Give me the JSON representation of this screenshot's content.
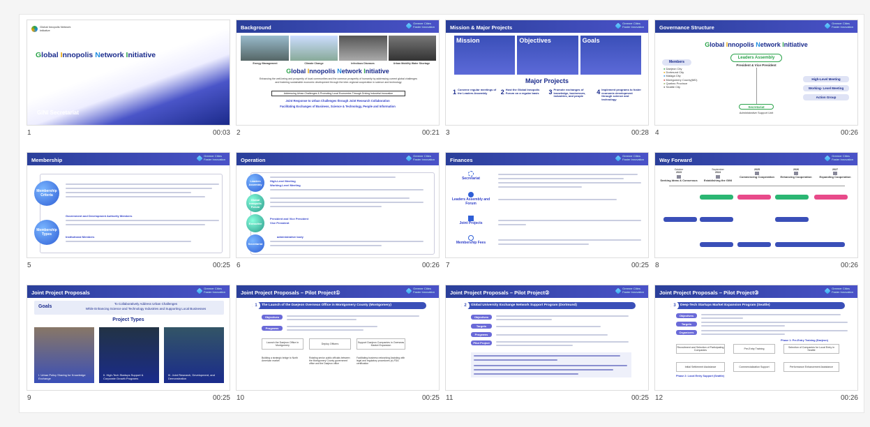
{
  "brand": {
    "line1": "Greener Cities",
    "line2": "Faster Innovation"
  },
  "gini": {
    "pre1": "G",
    "w1": "lobal ",
    "pre2": "I",
    "w2": "nnopolis ",
    "pre3": "N",
    "w3": "etwork ",
    "pre4": "I",
    "w4": "nitiative"
  },
  "slides": [
    {
      "num": "1",
      "duration": "00:03",
      "title": "",
      "footer": "GINI Secretariat",
      "logo_text": "Global Innopolis Network Initiative"
    },
    {
      "num": "2",
      "duration": "00:21",
      "title": "Background",
      "images": [
        "Energy Management",
        "Climate Change",
        "Infectious Diseases",
        "Urban Mobility Water Shortage"
      ],
      "body": "Enhancing the well-being and prosperity of local communities and the common prosperity of humanity by addressing current global challenges and fostering sustainable economic development through the inter-regional cooperation in science and technology",
      "box": "Addressing Urban Challenges & Promoting Local Economies Through Driving Industrial Innovation",
      "line1": "Joint Response to Urban Challenges through Joint Research Collaboration",
      "line2": "Facilitating Exchanges of Business, Science & Technology, People and Information"
    },
    {
      "num": "3",
      "duration": "00:28",
      "title": "Mission & Major Projects",
      "cols": [
        "Mission",
        "Objectives",
        "Goals"
      ],
      "major": "Major Projects",
      "projects": [
        {
          "n": "1",
          "t": "Convene regular meetings of the Leaders Assembly"
        },
        {
          "n": "2",
          "t": "Host the Global Innopolis Forum on a regular basis"
        },
        {
          "n": "3",
          "t": "Promote exchanges of knowledge, businesses, industries, and people"
        },
        {
          "n": "4",
          "t": "Implement programs to foster economic development through science and technology"
        }
      ]
    },
    {
      "num": "4",
      "duration": "00:26",
      "title": "Governance Structure",
      "members_label": "Members",
      "members": [
        "Daejeon City",
        "Dortmund City",
        "Malaga City",
        "Montgomery County(MD)",
        "Quebec Province",
        "Seattle City"
      ],
      "leaders": "Leaders Assembly",
      "pres": "President & Vice President",
      "right": [
        "High-Level Meeting",
        "Working- Level Meeting",
        "Action Group"
      ],
      "secretariat": "Secretariat",
      "admin": "Administrative Support Unit"
    },
    {
      "num": "5",
      "duration": "00:25",
      "title": "Membership",
      "c1": "Membership Criteria",
      "c2": "Membership Types",
      "t1": "Government and Development Authority Members",
      "t2": "Institutional Members"
    },
    {
      "num": "6",
      "duration": "00:26",
      "title": "Operation",
      "circles": [
        "Leaders Assembly",
        "Global Innopolis Forum",
        "Executive",
        "Secretariat"
      ],
      "hl1": "High-Level Meeting",
      "hl2": "Working-Level Meeting",
      "hl3": "President and Vice President",
      "hl4": "Vice President",
      "hl5": "administrative body"
    },
    {
      "num": "7",
      "duration": "00:25",
      "title": "Finances",
      "items": [
        "Secretariat",
        "Leaders Assembly and Forum",
        "Joint Projects",
        "Membership Fees"
      ]
    },
    {
      "num": "8",
      "duration": "00:26",
      "title": "Way Forward",
      "years": [
        {
          "month": "October",
          "year": "2023",
          "label": "Seeking Ideas & Consensus"
        },
        {
          "month": "September",
          "year": "2024",
          "label": "Establishing the GINI"
        },
        {
          "month": "",
          "year": "2025",
          "label": "Commencing Cooperation"
        },
        {
          "month": "",
          "year": "2026",
          "label": "Enhancing Cooperation"
        },
        {
          "month": "",
          "year": "2027",
          "label": "Expanding Cooperation"
        }
      ]
    },
    {
      "num": "9",
      "duration": "00:25",
      "title": "Joint Project Proposals",
      "goals": "Goals",
      "goal_text1": "To Collaboratively Address Urban Challenges",
      "goal_text2": "While Enhancing Science and Technology Industries and Supporting Local Businesses",
      "types": "Project Types",
      "cards": [
        "I. Urban Policy Sharing for Knowledge Exchange",
        "II. High-Tech Startups Support & Corporate Growth Programs",
        "III. Joint Research, Development, and Demonstration"
      ]
    },
    {
      "num": "10",
      "duration": "00:25",
      "title": "Joint Project Proposals – Pilot Project①",
      "banner_n": "1",
      "banner": "The Launch of the Daejeon Overseas Office in Montgomery County (Montgomery)",
      "tags": [
        "Objectives",
        "Programs"
      ],
      "flow": [
        "Launch the Daejeon Office in Montgomery",
        "Deploy Officers",
        "Support Daejeon Companies in Overseas Market Expansion"
      ],
      "notes": [
        "Building a strategic bridge to North American market",
        "Rotating senior public officials between the Montgomery County government office and the Daejeon office",
        "Facilitating business networking Assisting with legal and regulatory procedures (e) FDA certification"
      ]
    },
    {
      "num": "11",
      "duration": "00:25",
      "title": "Joint Project Proposals – Pilot Project②",
      "banner_n": "2",
      "banner": "Global University Exchange Network Support Program (Dortmund)",
      "tags": [
        "Objectives",
        "Targets",
        "Programs",
        "Pilot Project"
      ]
    },
    {
      "num": "12",
      "duration": "00:26",
      "title": "Joint Project Proposals – Pilot Project③",
      "banner_n": "3",
      "banner": "Deep-Tech Startups Market Expansion Program (Seattle)",
      "tags": [
        "Objectives",
        "Targets",
        "Organizers"
      ],
      "phase1": "Phase 1: Pre-Entry Training (Daejeon)",
      "phase2": "Phase 2: Local Entry Support (Seattle)",
      "flow": [
        "Recruitment and Selection of Participating Companies",
        "Pre-Entry Training",
        "Selection of Companies for Local Entry in Seattle",
        "Initial Settlement Assistance",
        "Commercialization Support",
        "Performance Enhancement Assistance"
      ]
    }
  ]
}
